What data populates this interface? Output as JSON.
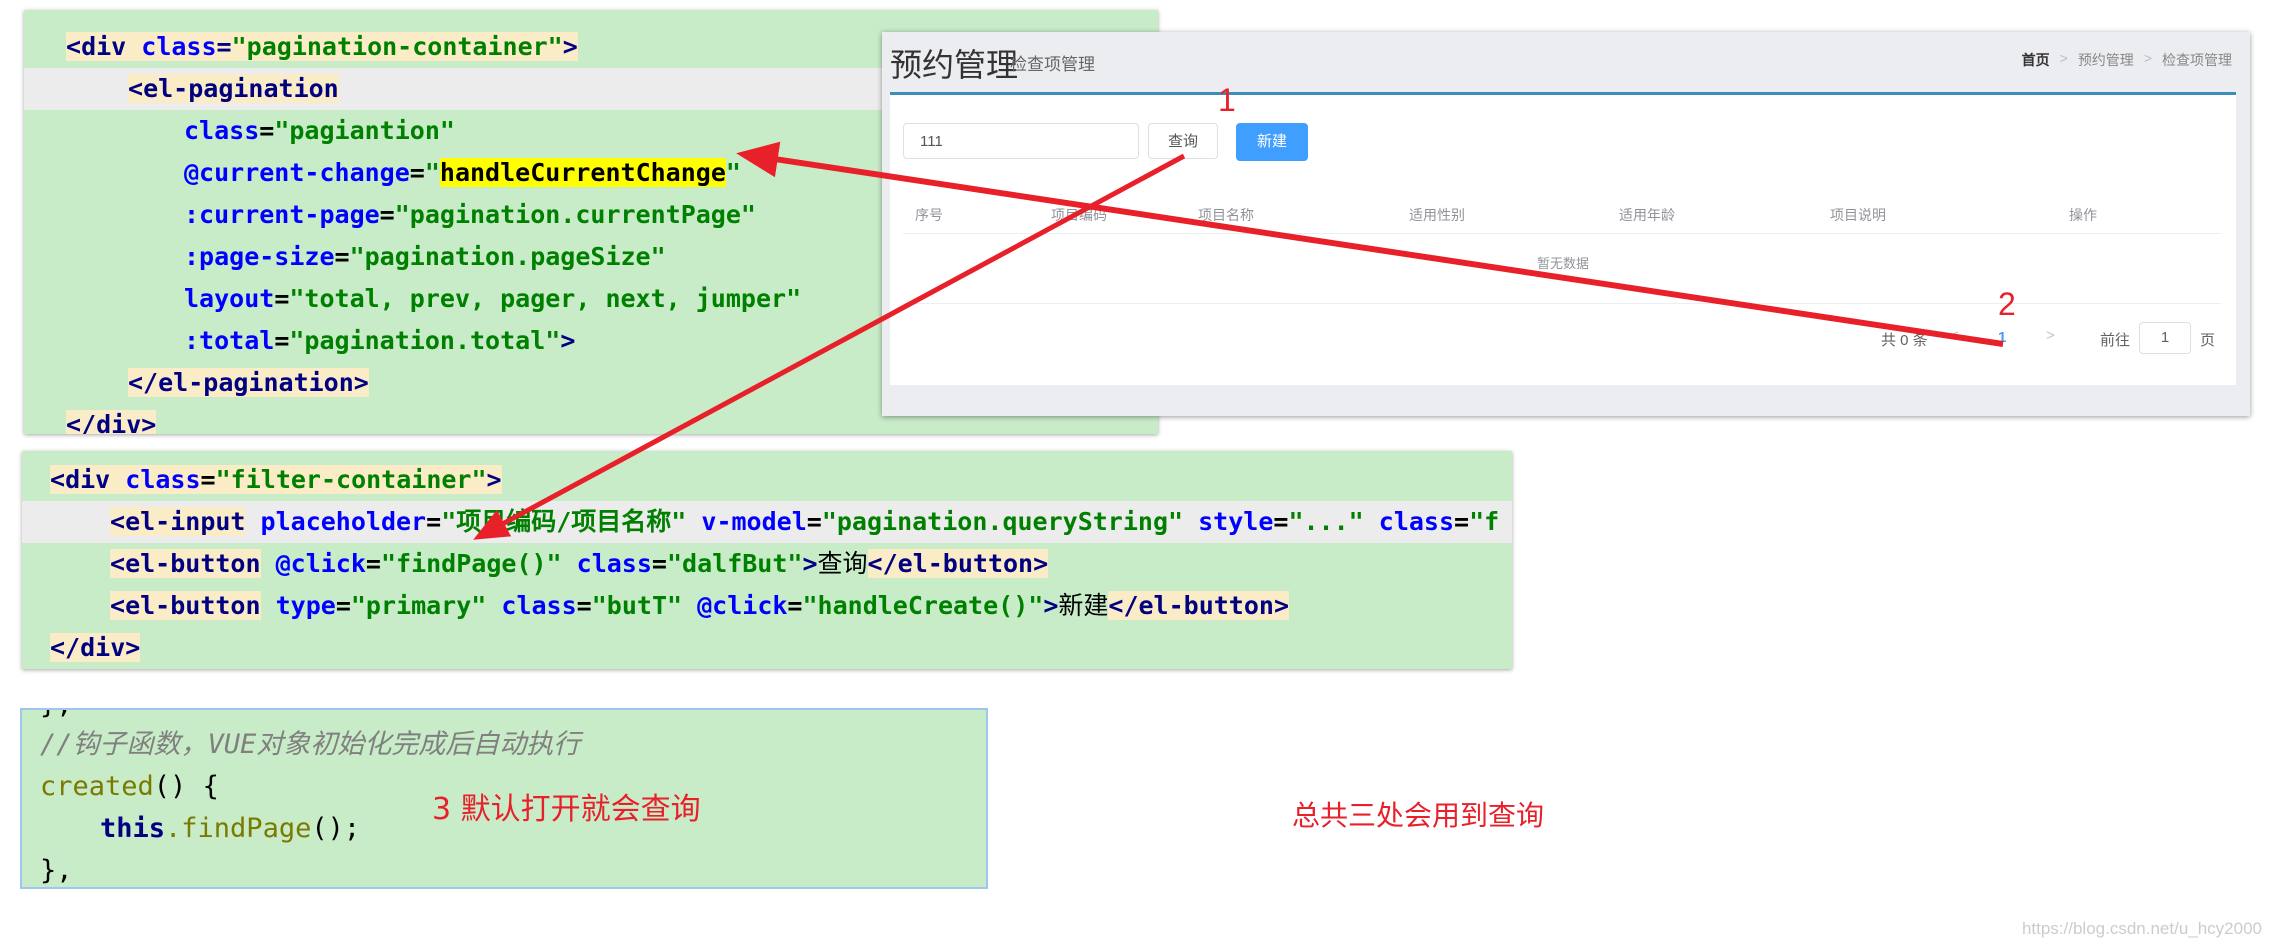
{
  "pagination_code": {
    "lines": [
      {
        "indent": 1,
        "open": "<",
        "tag": "div",
        "sp": " ",
        "attr": "class",
        "eq": "=",
        "value": "\"pagination-container\"",
        "close": ">"
      },
      {
        "indent": 2,
        "open": "<",
        "tag": "el-pagination"
      },
      {
        "indent": 3,
        "attr": "class",
        "eq": "=",
        "value": "\"pagiantion\""
      },
      {
        "indent": 3,
        "attr": "@current-change",
        "eq": "=",
        "q1": "\"",
        "hl": "handleCurrentChange",
        "q2": "\""
      },
      {
        "indent": 3,
        "attr": ":current-page",
        "eq": "=",
        "value": "\"pagination.currentPage\""
      },
      {
        "indent": 3,
        "attr": ":page-size",
        "eq": "=",
        "value": "\"pagination.pageSize\""
      },
      {
        "indent": 3,
        "attr": "layout",
        "eq": "=",
        "value": "\"total, prev, pager, next, jumper\""
      },
      {
        "indent": 3,
        "attr": ":total",
        "eq": "=",
        "value": "\"pagination.total\"",
        "close": ">"
      },
      {
        "indent": 2,
        "open": "</",
        "tag": "el-pagination",
        "close": ">"
      },
      {
        "indent": 1,
        "open": "</",
        "tag": "div",
        "close": ">"
      }
    ]
  },
  "filter_code": {
    "line1": {
      "open": "<",
      "tag": "div",
      "attr": "class",
      "value": "\"filter-container\"",
      "close": ">"
    },
    "line2": {
      "open": "<",
      "tag": "el-input",
      "a1": "placeholder",
      "v1": "\"项目编码/项目名称\"",
      "a2": "v-model",
      "v2": "\"pagination.queryString\"",
      "a3": "style",
      "v3": "\"...\"",
      "a4": "class",
      "v4": "\"f"
    },
    "line3": {
      "open": "<",
      "tag": "el-button",
      "a1": "@click",
      "v1": "\"findPage()\"",
      "a2": "class",
      "v2": "\"dalfBut\"",
      "gt": ">",
      "text": "查询",
      "endopen": "</",
      "endtag": "el-button",
      "close": ">"
    },
    "line4": {
      "open": "<",
      "tag": "el-button",
      "a1": "type",
      "v1": "\"primary\"",
      "a2": "class",
      "v2": "\"butT\"",
      "a3": "@click",
      "v3": "\"handleCreate()\"",
      "gt": ">",
      "text": "新建",
      "endopen": "</",
      "endtag": "el-button",
      "close": ">"
    },
    "line5": {
      "open": "</",
      "tag": "div",
      "close": ">"
    }
  },
  "created_code": {
    "line0": "},",
    "comment": "//钩子函数，VUE对象初始化完成后自动执行",
    "fn_name": "created",
    "fn_sig": "() {",
    "this_kw": "this",
    "call": ".findPage",
    "call_end": "();",
    "close": "},"
  },
  "ui": {
    "title": "预约管理",
    "subtitle": "检查项管理",
    "breadcrumb": [
      "首页",
      ">",
      "预约管理",
      ">",
      "检查项管理"
    ],
    "search_value": "111",
    "query_button": "查询",
    "new_button": "新建",
    "columns": [
      "序号",
      "项目编码",
      "项目名称",
      "适用性别",
      "适用年龄",
      "项目说明",
      "操作"
    ],
    "empty_text": "暂无数据",
    "pager": {
      "total_text": "共 0 条",
      "prev": "<",
      "current_page": "1",
      "next": ">",
      "goto_text": "前往",
      "goto_value": "1",
      "page_text": "页"
    }
  },
  "annotations": {
    "marker_1": "1",
    "marker_2": "2",
    "marker_3": "3 默认打开就会查询",
    "total_note": "总共三处会用到查询",
    "watermark": "https://blog.csdn.net/u_hcy2000"
  },
  "colors": {
    "arrow": "#e8202a",
    "code_bg": "#c8ebc8",
    "primary": "#409eff"
  }
}
